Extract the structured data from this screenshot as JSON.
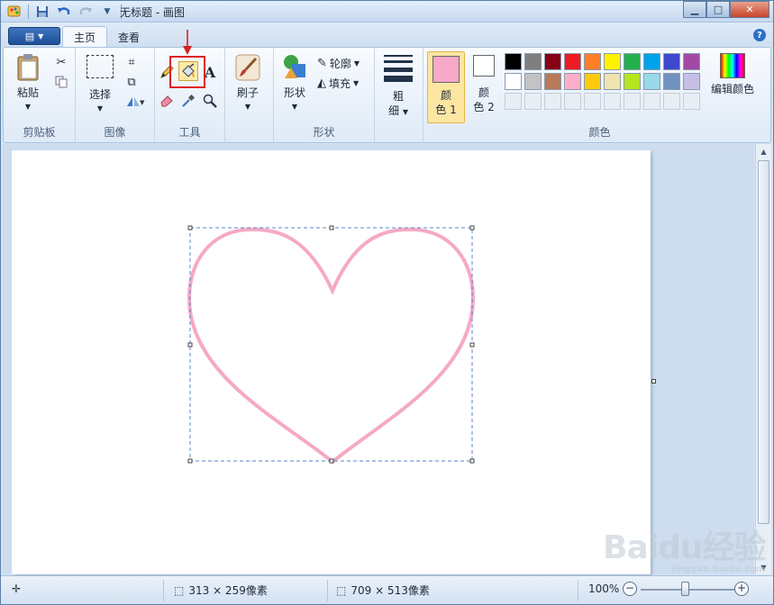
{
  "window": {
    "title": "无标题 - 画图"
  },
  "tabs": [
    {
      "label": "主页"
    },
    {
      "label": "查看"
    }
  ],
  "ribbon": {
    "clipboard": {
      "label": "剪贴板",
      "paste": "粘贴"
    },
    "image": {
      "label": "图像",
      "select": "选择"
    },
    "tools": {
      "label": "工具"
    },
    "brushes": {
      "label": "刷子"
    },
    "shapes": {
      "label": "形状",
      "shape_btn": "形状",
      "outline": "轮廓",
      "fill": "填充"
    },
    "size": {
      "line1": "粗",
      "line2": "细"
    },
    "color1": {
      "line1": "颜",
      "line2": "色 1",
      "color": "#f8a8c8"
    },
    "color2": {
      "line1": "颜",
      "line2": "色 2",
      "color": "#ffffff"
    },
    "colors": {
      "label": "颜色",
      "edit": "编辑颜色",
      "row1": [
        "#000000",
        "#7f7f7f",
        "#880015",
        "#ed1c24",
        "#ff7f27",
        "#fff200",
        "#22b14c",
        "#00a2e8",
        "#3f48cc",
        "#a349a4"
      ],
      "row2": [
        "#ffffff",
        "#c3c3c3",
        "#b97a57",
        "#ffaec9",
        "#ffc90e",
        "#efe4b0",
        "#b5e61d",
        "#99d9ea",
        "#7092be",
        "#c8bfe7"
      ]
    }
  },
  "highlight": {
    "color": "#e02020"
  },
  "status": {
    "selection_size": "313 × 259像素",
    "canvas_size": "709 × 513像素",
    "zoom": "100%"
  },
  "watermark": {
    "text": "Baidu经验",
    "sub": "jingyan.baidu.com"
  },
  "drawing": {
    "heart_color": "#f5a9c5"
  }
}
